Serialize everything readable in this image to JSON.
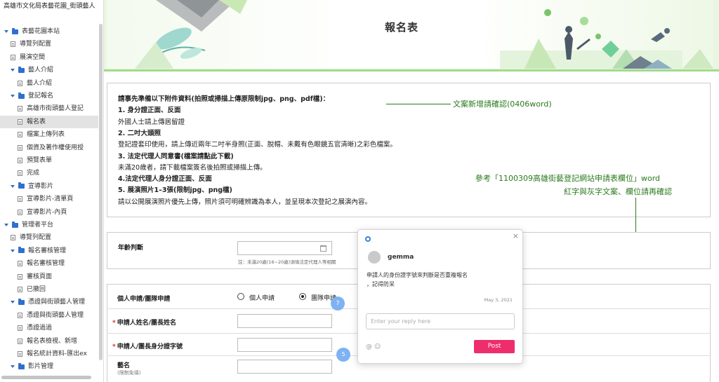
{
  "sidebar": {
    "site_title": "高雄市文化局表藝花園_街頭藝人",
    "items": [
      {
        "label": "表藝花園本站",
        "type": "folder",
        "level": 0
      },
      {
        "label": "導覽列配置",
        "type": "page",
        "level": 1
      },
      {
        "label": "展演空間",
        "type": "page",
        "level": 1
      },
      {
        "label": "藝人介紹",
        "type": "folder",
        "level": 1
      },
      {
        "label": "藝人介紹",
        "type": "page",
        "level": 2
      },
      {
        "label": "登記報名",
        "type": "folder",
        "level": 1
      },
      {
        "label": "高雄市街頭藝人登記",
        "type": "page",
        "level": 2
      },
      {
        "label": "報名表",
        "type": "page",
        "level": 2,
        "selected": true
      },
      {
        "label": "檔案上傳列表",
        "type": "page",
        "level": 2
      },
      {
        "label": "個資及著作權使用授",
        "type": "page",
        "level": 2
      },
      {
        "label": "預覽表單",
        "type": "page",
        "level": 2
      },
      {
        "label": "完成",
        "type": "page",
        "level": 2
      },
      {
        "label": "宣導影片",
        "type": "folder",
        "level": 1
      },
      {
        "label": "宣導影片-清單頁",
        "type": "page",
        "level": 2
      },
      {
        "label": "宣導影片-內頁",
        "type": "page",
        "level": 2
      },
      {
        "label": "管理者平台",
        "type": "folder",
        "level": 0
      },
      {
        "label": "導覽列配置",
        "type": "page",
        "level": 1
      },
      {
        "label": "報名審核管理",
        "type": "folder",
        "level": 1
      },
      {
        "label": "報名審核管理",
        "type": "page",
        "level": 2
      },
      {
        "label": "審核頁面",
        "type": "page",
        "level": 2
      },
      {
        "label": "已撤回",
        "type": "page",
        "level": 2
      },
      {
        "label": "憑證與街頭藝人管理",
        "type": "folder",
        "level": 1
      },
      {
        "label": "憑證與街頭藝人管理",
        "type": "page",
        "level": 2
      },
      {
        "label": "憑證過過",
        "type": "page",
        "level": 2
      },
      {
        "label": "報名表檢視、新增",
        "type": "page",
        "level": 2
      },
      {
        "label": "報名統計資料-匯出ex",
        "type": "page",
        "level": 2
      },
      {
        "label": "影片管理",
        "type": "folder",
        "level": 1
      }
    ]
  },
  "banner": {
    "title": "報名表"
  },
  "instructions": {
    "lines": [
      {
        "text": "請事先準備以下附件資料(拍照或掃描上傳原限制jpg、png、pdf檔)：",
        "bold": true
      },
      {
        "text": "1. 身分證正面、反面",
        "bold": true
      },
      {
        "text": "外國人士請上傳居留證",
        "bold": false
      },
      {
        "text": "2. 二吋大頭照",
        "bold": true
      },
      {
        "text": "登記證套印使用，請上傳近兩年二吋半身照(正面、脫帽、未戴有色眼鏡五官清晰)之彩色檔案。",
        "bold": false
      },
      {
        "text": "3. 法定代理人同意書(檔案請點此下載)",
        "bold": true
      },
      {
        "text": "未滿20歲者，請下載檔案簽名後拍照或掃描上傳。",
        "bold": false
      },
      {
        "text": "4.法定代理人身分證正面、反面",
        "bold": true
      },
      {
        "text": "5. 展演照片1–3張(限制jpg、png檔)",
        "bold": true
      },
      {
        "text": "請以公開展演照片優先上傳，照片須可明確辨識為本人，並呈現本次登記之展演內容。",
        "bold": false
      }
    ]
  },
  "annotations": {
    "note1": "文案新增請確認(0406word)",
    "note2_line1": "參考「1100309高雄街藝登記網站申請表欄位」word",
    "note2_line2": "紅字與灰字文案、欄位請再確認"
  },
  "form": {
    "age_label": "年齡判斷",
    "age_hint": "註：未滿20歲(16~20歲)須填法定代理人等相關",
    "apply_type_label": "個人申請/團隊申請",
    "apply_type_options": [
      "個人申請",
      "團隊申請"
    ],
    "apply_type_selected": "團隊申請",
    "name_label": "申請人姓名/團長姓名",
    "id_label": "申請人/團長身分證字號",
    "stage_name_label": "藝名",
    "stage_name_sub": "(限制免填)",
    "required_mark": "*"
  },
  "comment": {
    "user": "gemma",
    "message_line1": "申請人的身份證字號來判斷是否重複報名",
    "message_line2": "，記得防呆",
    "date": "May 3, 2021",
    "reply_placeholder": "Enter your reply here",
    "tools": "@ ☺",
    "post_label": "Post",
    "close_glyph": "×"
  },
  "markers": {
    "marker_a": "7",
    "marker_b": "5"
  },
  "colors": {
    "annotation": "#2b7a1e",
    "post_button": "#ee2d6c",
    "folder": "#2f6fcf",
    "required": "#d9302a",
    "banner_stripe": "#9fdc8c"
  }
}
